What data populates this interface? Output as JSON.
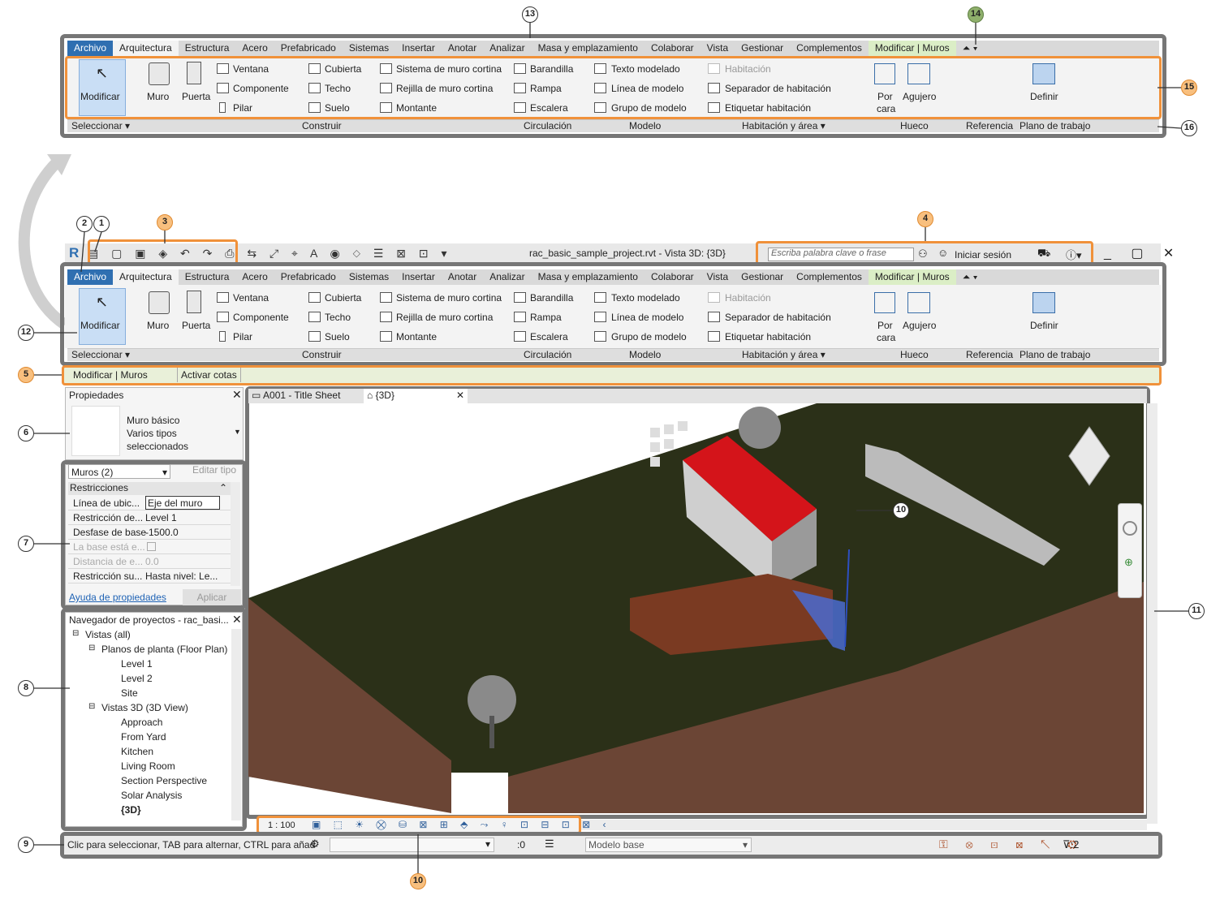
{
  "ribbon_tabs": [
    "Archivo",
    "Arquitectura",
    "Estructura",
    "Acero",
    "Prefabricado",
    "Sistemas",
    "Insertar",
    "Anotar",
    "Analizar",
    "Masa y emplazamiento",
    "Colaborar",
    "Vista",
    "Gestionar",
    "Complementos",
    "Modificar | Muros"
  ],
  "ribbon": {
    "modify": "Modificar",
    "wall": "Muro",
    "door": "Puerta",
    "window": "Ventana",
    "component": "Componente",
    "column": "Pilar",
    "roof": "Cubierta",
    "ceiling": "Techo",
    "floor": "Suelo",
    "curtain_system": "Sistema de muro cortina",
    "curtain_grid": "Rejilla de muro cortina",
    "mullion": "Montante",
    "railing": "Barandilla",
    "ramp": "Rampa",
    "stair": "Escalera",
    "model_text": "Texto modelado",
    "model_line": "Línea de modelo",
    "model_group": "Grupo de modelo",
    "room": "Habitación",
    "room_separator": "Separador  de habitación",
    "tag_room": "Etiquetar  habitación",
    "by_face_1": "Por",
    "by_face_2": "cara",
    "shaft": "Agujero",
    "set": "Definir"
  },
  "panels": {
    "select": "Seleccionar",
    "build": "Construir",
    "circulation": "Circulación",
    "model": "Modelo",
    "room_area": "Habitación y área",
    "opening": "Hueco",
    "datum": "Referencia",
    "work_plane": "Plano de trabajo"
  },
  "titlebar": {
    "title": "rac_basic_sample_project.rvt - Vista 3D: {3D}",
    "search_placeholder": "Escriba palabra clave o frase",
    "sign_in": "Iniciar sesión"
  },
  "options_bar": {
    "context": "Modificar | Muros",
    "activate_dims": "Activar cotas"
  },
  "properties": {
    "title": "Propiedades",
    "type_line1": "Muro básico",
    "type_line2": "Varios tipos",
    "type_line3": "seleccionados",
    "filter": "Muros (2)",
    "edit_type": "Editar tipo",
    "group": "Restricciones",
    "rows": [
      {
        "name": "Línea de ubic...",
        "value": "Eje del muro"
      },
      {
        "name": "Restricción de...",
        "value": "Level 1"
      },
      {
        "name": "Desfase de base",
        "value": "-1500.0"
      },
      {
        "name": "La base está e...",
        "value": ""
      },
      {
        "name": "Distancia de e...",
        "value": "0.0"
      },
      {
        "name": "Restricción su...",
        "value": "Hasta nivel: Le..."
      }
    ],
    "help": "Ayuda de propiedades",
    "apply": "Aplicar"
  },
  "browser": {
    "title": "Navegador de proyectos - rac_basi...",
    "items": [
      {
        "label": "Vistas (all)",
        "level": 0
      },
      {
        "label": "Planos de planta (Floor Plan)",
        "level": 1
      },
      {
        "label": "Level 1",
        "level": 2
      },
      {
        "label": "Level 2",
        "level": 2
      },
      {
        "label": "Site",
        "level": 2
      },
      {
        "label": "Vistas 3D (3D View)",
        "level": 1
      },
      {
        "label": "Approach",
        "level": 2
      },
      {
        "label": "From Yard",
        "level": 2
      },
      {
        "label": "Kitchen",
        "level": 2
      },
      {
        "label": "Living Room",
        "level": 2
      },
      {
        "label": "Section Perspective",
        "level": 2
      },
      {
        "label": "Solar Analysis",
        "level": 2
      },
      {
        "label": "{3D}",
        "level": 2
      }
    ]
  },
  "view_tabs": [
    "A001 - Title Sheet",
    "{3D}"
  ],
  "view_controls": {
    "scale": "1 : 100"
  },
  "status": {
    "text": "Clic para seleccionar, TAB para alternar, CTRL para añad",
    "count": ":0",
    "model": "Modelo base",
    "filter": ":2"
  },
  "callouts": [
    "1",
    "2",
    "3",
    "4",
    "5",
    "6",
    "7",
    "8",
    "9",
    "10",
    "11",
    "12",
    "13",
    "14",
    "15",
    "16"
  ],
  "colors": {
    "accent": "#f0913a",
    "frame": "#767676",
    "file_tab": "#2f6fb1",
    "roof": "#d4141a"
  }
}
